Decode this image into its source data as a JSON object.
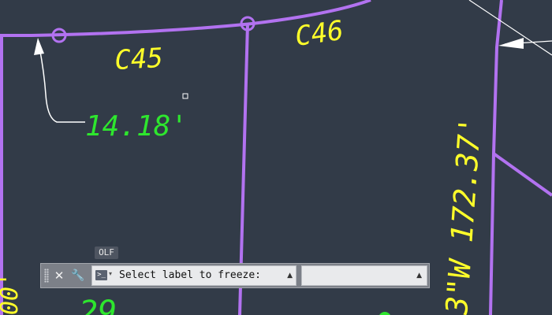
{
  "drawing": {
    "labels": {
      "c45": "C45",
      "c46": "C46",
      "dimension": "14.18'",
      "bearing": "3\"W 172.37'",
      "left_edge": "00'",
      "bottom_partial": "29"
    },
    "colors": {
      "background": "#323b48",
      "lines": "#b272f0",
      "label_yellow": "#ffff2a",
      "label_green": "#2ee62e",
      "leader": "#ffffff"
    }
  },
  "command_line": {
    "tag": "OLF",
    "prompt": "Select label to freeze:",
    "recent_value": "",
    "icons": {
      "close": "close-icon",
      "settings": "wrench-icon",
      "prompt": "command-prompt-icon",
      "history": "chevron-up-icon"
    }
  }
}
